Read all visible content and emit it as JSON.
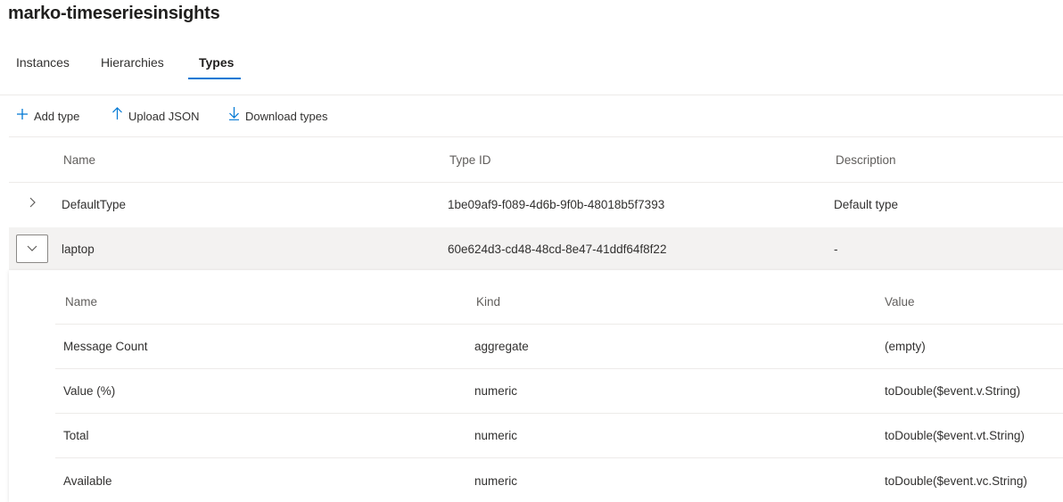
{
  "header": {
    "title": "marko-timeseriesinsights"
  },
  "tabs": [
    {
      "label": "Instances"
    },
    {
      "label": "Hierarchies"
    },
    {
      "label": "Types",
      "active": true
    }
  ],
  "toolbar": {
    "add_type": "Add type",
    "upload_json": "Upload JSON",
    "download_types": "Download types"
  },
  "types_table": {
    "columns": {
      "name": "Name",
      "type_id": "Type ID",
      "description": "Description"
    },
    "rows": [
      {
        "name": "DefaultType",
        "type_id": "1be09af9-f089-4d6b-9f0b-48018b5f7393",
        "description": "Default type",
        "expanded": false
      },
      {
        "name": "laptop",
        "type_id": "60e624d3-cd48-48cd-8e47-41ddf64f8f22",
        "description": "-",
        "expanded": true
      }
    ]
  },
  "variables_table": {
    "columns": {
      "name": "Name",
      "kind": "Kind",
      "value": "Value"
    },
    "rows": [
      {
        "name": "Message Count",
        "kind": "aggregate",
        "value": "(empty)"
      },
      {
        "name": "Value (%)",
        "kind": "numeric",
        "value": "toDouble($event.v.String)"
      },
      {
        "name": "Total",
        "kind": "numeric",
        "value": "toDouble($event.vt.String)"
      },
      {
        "name": "Available",
        "kind": "numeric",
        "value": "toDouble($event.vc.String)"
      }
    ]
  },
  "colors": {
    "accent": "#0078d4",
    "selected_row": "#f3f2f1",
    "divider": "#edebe9"
  },
  "icons": {
    "add": "add-icon",
    "upload": "upload-icon",
    "download": "download-icon",
    "expand": "chevron-right-icon",
    "collapse": "chevron-down-icon"
  }
}
